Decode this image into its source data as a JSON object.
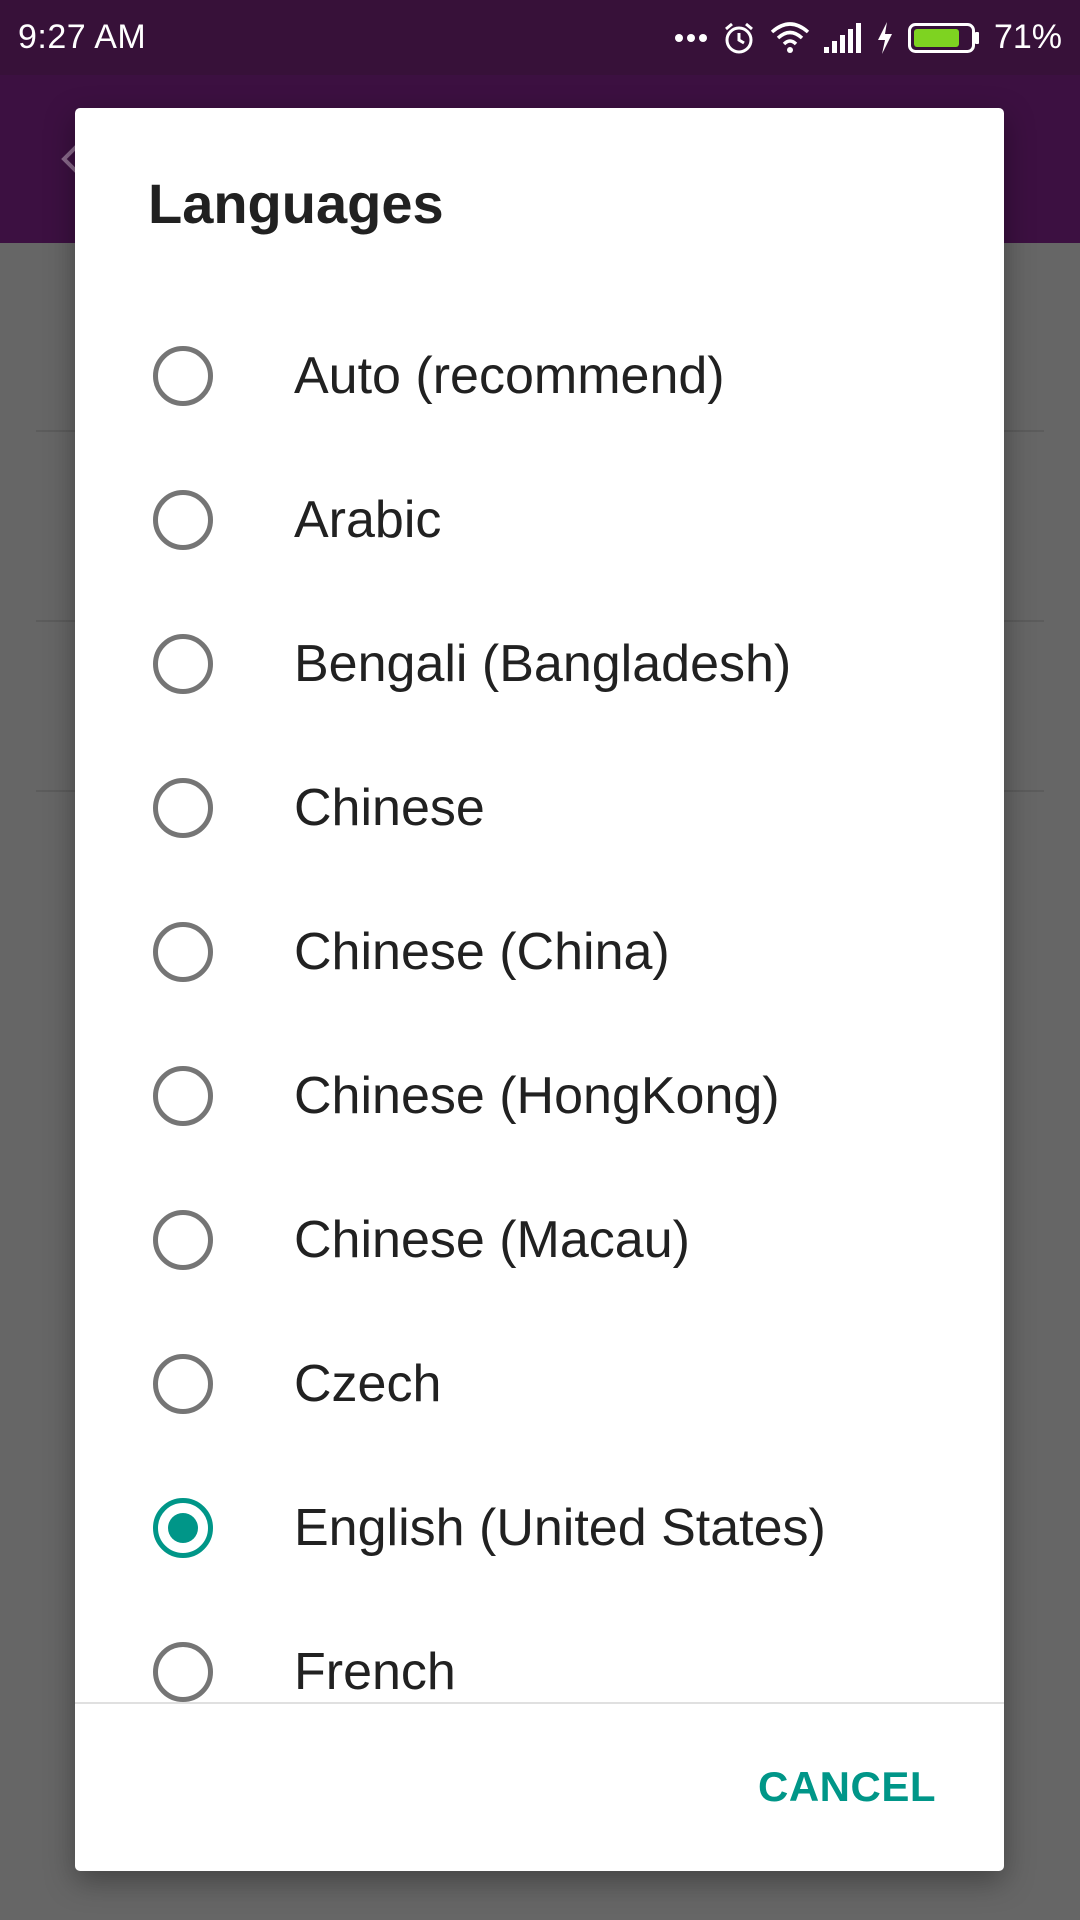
{
  "status_bar": {
    "time": "9:27  AM",
    "battery_percent": "71%",
    "icons": [
      "more-dots-icon",
      "alarm-icon",
      "wifi-icon",
      "signal-icon",
      "charging-icon",
      "battery-icon"
    ]
  },
  "dialog": {
    "title": "Languages",
    "options": [
      {
        "label": "Auto (recommend)",
        "selected": false
      },
      {
        "label": "Arabic",
        "selected": false
      },
      {
        "label": "Bengali (Bangladesh)",
        "selected": false
      },
      {
        "label": "Chinese",
        "selected": false
      },
      {
        "label": "Chinese (China)",
        "selected": false
      },
      {
        "label": "Chinese (HongKong)",
        "selected": false
      },
      {
        "label": "Chinese (Macau)",
        "selected": false
      },
      {
        "label": "Czech",
        "selected": false
      },
      {
        "label": "English (United States)",
        "selected": true
      },
      {
        "label": "French",
        "selected": false
      }
    ],
    "cancel_label": "CANCEL"
  },
  "colors": {
    "accent": "#009688",
    "status_bar_bg": "#371139",
    "app_bar_bg": "#3c1041",
    "scrim": "#666666"
  }
}
